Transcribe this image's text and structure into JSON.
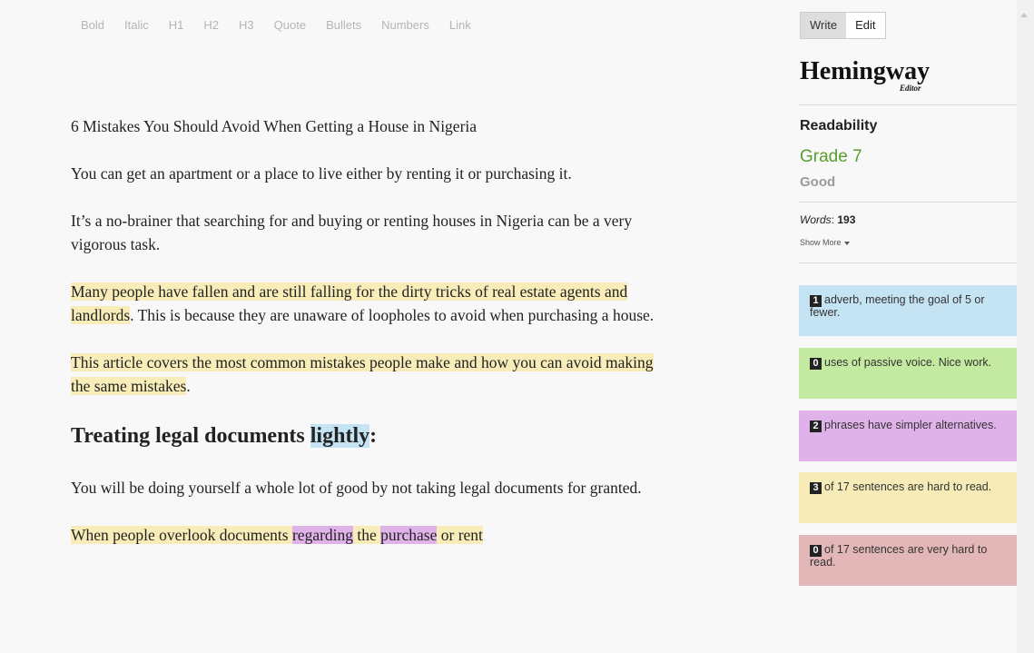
{
  "toolbar": {
    "items": [
      "Bold",
      "Italic",
      "H1",
      "H2",
      "H3",
      "Quote",
      "Bullets",
      "Numbers",
      "Link"
    ]
  },
  "document": {
    "p1": "6 Mistakes You Should Avoid When Getting a House in Nigeria",
    "p2": "You can get an apartment or a place to live either by renting it or purchasing it.",
    "p3": "It’s a no-brainer that searching for and buying or renting houses in Nigeria can be a very vigorous task.",
    "p4_hl": "Many people have fallen and are still falling for the dirty tricks of real estate agents and landlords",
    "p4_rest": ". This is because they are unaware of loopholes to avoid when purchasing a house.",
    "p5_hl": "This article covers the most common mistakes people make and how you can avoid making the same mistakes",
    "p5_rest": ".",
    "h2_start": "Treating legal documents ",
    "h2_adverb": "lightly",
    "h2_end": ":",
    "p6": "You will be doing yourself a whole lot of good by not taking legal documents for granted.",
    "p7_a": "When people overlook documents ",
    "p7_b": "regarding",
    "p7_c": " the ",
    "p7_d": "purchase",
    "p7_e": " or rent"
  },
  "sidebar": {
    "mode": {
      "write": "Write",
      "edit": "Edit"
    },
    "logo": {
      "title": "Hemingway",
      "sub": "Editor"
    },
    "readability": {
      "heading": "Readability",
      "grade": "Grade 7",
      "grade_desc": "Good"
    },
    "words": {
      "label": "Words",
      "count": "193"
    },
    "show_more": "Show More",
    "cards": [
      {
        "count": "1",
        "text": "adverb, meeting the goal of 5 or fewer.",
        "color": "#c4e3f3"
      },
      {
        "count": "0",
        "text": "uses of passive voice. Nice work.",
        "color": "#c4eaa1"
      },
      {
        "count": "2",
        "text": "phrases have simpler alternatives.",
        "color": "#e0b2ea"
      },
      {
        "count": "3",
        "text": "of 17 sentences are hard to read.",
        "color": "#f7ebb8"
      },
      {
        "count": "0",
        "text": "of 17 sentences are very hard to read.",
        "color": "#e3b7b7"
      }
    ]
  },
  "colors": {
    "adverb": "#c4e3f3",
    "hard": "#f8edb8",
    "simpler": "#e0b2ea",
    "grade_good": "#5a9d2e"
  }
}
